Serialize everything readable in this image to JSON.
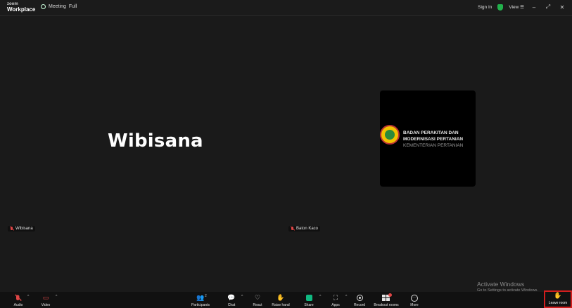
{
  "titlebar": {
    "brand_top": "zoom",
    "brand_bottom": "Workplace",
    "meeting_label": "Meeting",
    "meeting_sub": "Full",
    "sign_in": "Sign In",
    "view_label": "View"
  },
  "stage": {
    "main_name": "Wibisana",
    "left_tile_label": "Wibisana",
    "right_tile_label": "Baton Kaco",
    "logo_line1": "BADAN PERAKITAN DAN",
    "logo_line2": "MODERNISASI PERTANIAN",
    "logo_line3": "KEMENTERIAN PERTANIAN"
  },
  "watermark": {
    "line1": "Activate Windows",
    "line2": "Go to Settings to activate Windows."
  },
  "toolbar": {
    "audio": "Audio",
    "video": "Video",
    "participants": "Participants",
    "participants_count": "2",
    "chat": "Chat",
    "react": "React",
    "raise_hand": "Raise hand",
    "share": "Share",
    "apps": "Apps",
    "record": "Record",
    "breakout_rooms": "Breakout rooms",
    "more": "More",
    "leave_room": "Leave room"
  },
  "colors": {
    "background": "#1a1a1a",
    "toolbar": "#111111",
    "share_green": "#10b981",
    "muted_red": "#e04646",
    "leave_outline": "#d21e1e"
  },
  "icons": [
    "mic-off-icon",
    "video-off-icon",
    "participants-icon",
    "chat-icon",
    "react-icon",
    "raise-hand-icon",
    "share-icon",
    "apps-icon",
    "record-icon",
    "breakout-rooms-icon",
    "more-icon",
    "leave-icon",
    "shield-icon",
    "minimize-icon",
    "maximize-icon",
    "close-icon"
  ]
}
